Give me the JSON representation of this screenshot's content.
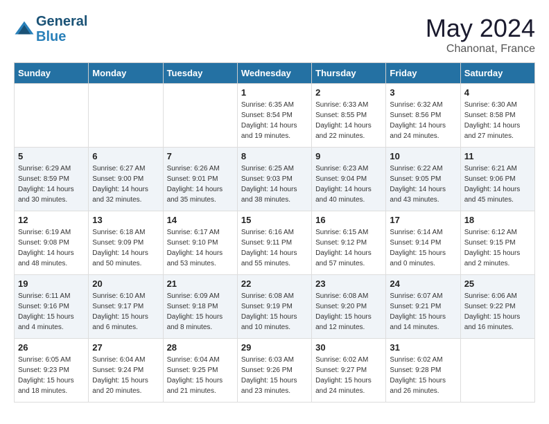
{
  "header": {
    "logo_general": "General",
    "logo_blue": "Blue",
    "month_title": "May 2024",
    "location": "Chanonat, France"
  },
  "days_of_week": [
    "Sunday",
    "Monday",
    "Tuesday",
    "Wednesday",
    "Thursday",
    "Friday",
    "Saturday"
  ],
  "weeks": [
    [
      {
        "day": "",
        "info": ""
      },
      {
        "day": "",
        "info": ""
      },
      {
        "day": "",
        "info": ""
      },
      {
        "day": "1",
        "info": "Sunrise: 6:35 AM\nSunset: 8:54 PM\nDaylight: 14 hours\nand 19 minutes."
      },
      {
        "day": "2",
        "info": "Sunrise: 6:33 AM\nSunset: 8:55 PM\nDaylight: 14 hours\nand 22 minutes."
      },
      {
        "day": "3",
        "info": "Sunrise: 6:32 AM\nSunset: 8:56 PM\nDaylight: 14 hours\nand 24 minutes."
      },
      {
        "day": "4",
        "info": "Sunrise: 6:30 AM\nSunset: 8:58 PM\nDaylight: 14 hours\nand 27 minutes."
      }
    ],
    [
      {
        "day": "5",
        "info": "Sunrise: 6:29 AM\nSunset: 8:59 PM\nDaylight: 14 hours\nand 30 minutes."
      },
      {
        "day": "6",
        "info": "Sunrise: 6:27 AM\nSunset: 9:00 PM\nDaylight: 14 hours\nand 32 minutes."
      },
      {
        "day": "7",
        "info": "Sunrise: 6:26 AM\nSunset: 9:01 PM\nDaylight: 14 hours\nand 35 minutes."
      },
      {
        "day": "8",
        "info": "Sunrise: 6:25 AM\nSunset: 9:03 PM\nDaylight: 14 hours\nand 38 minutes."
      },
      {
        "day": "9",
        "info": "Sunrise: 6:23 AM\nSunset: 9:04 PM\nDaylight: 14 hours\nand 40 minutes."
      },
      {
        "day": "10",
        "info": "Sunrise: 6:22 AM\nSunset: 9:05 PM\nDaylight: 14 hours\nand 43 minutes."
      },
      {
        "day": "11",
        "info": "Sunrise: 6:21 AM\nSunset: 9:06 PM\nDaylight: 14 hours\nand 45 minutes."
      }
    ],
    [
      {
        "day": "12",
        "info": "Sunrise: 6:19 AM\nSunset: 9:08 PM\nDaylight: 14 hours\nand 48 minutes."
      },
      {
        "day": "13",
        "info": "Sunrise: 6:18 AM\nSunset: 9:09 PM\nDaylight: 14 hours\nand 50 minutes."
      },
      {
        "day": "14",
        "info": "Sunrise: 6:17 AM\nSunset: 9:10 PM\nDaylight: 14 hours\nand 53 minutes."
      },
      {
        "day": "15",
        "info": "Sunrise: 6:16 AM\nSunset: 9:11 PM\nDaylight: 14 hours\nand 55 minutes."
      },
      {
        "day": "16",
        "info": "Sunrise: 6:15 AM\nSunset: 9:12 PM\nDaylight: 14 hours\nand 57 minutes."
      },
      {
        "day": "17",
        "info": "Sunrise: 6:14 AM\nSunset: 9:14 PM\nDaylight: 15 hours\nand 0 minutes."
      },
      {
        "day": "18",
        "info": "Sunrise: 6:12 AM\nSunset: 9:15 PM\nDaylight: 15 hours\nand 2 minutes."
      }
    ],
    [
      {
        "day": "19",
        "info": "Sunrise: 6:11 AM\nSunset: 9:16 PM\nDaylight: 15 hours\nand 4 minutes."
      },
      {
        "day": "20",
        "info": "Sunrise: 6:10 AM\nSunset: 9:17 PM\nDaylight: 15 hours\nand 6 minutes."
      },
      {
        "day": "21",
        "info": "Sunrise: 6:09 AM\nSunset: 9:18 PM\nDaylight: 15 hours\nand 8 minutes."
      },
      {
        "day": "22",
        "info": "Sunrise: 6:08 AM\nSunset: 9:19 PM\nDaylight: 15 hours\nand 10 minutes."
      },
      {
        "day": "23",
        "info": "Sunrise: 6:08 AM\nSunset: 9:20 PM\nDaylight: 15 hours\nand 12 minutes."
      },
      {
        "day": "24",
        "info": "Sunrise: 6:07 AM\nSunset: 9:21 PM\nDaylight: 15 hours\nand 14 minutes."
      },
      {
        "day": "25",
        "info": "Sunrise: 6:06 AM\nSunset: 9:22 PM\nDaylight: 15 hours\nand 16 minutes."
      }
    ],
    [
      {
        "day": "26",
        "info": "Sunrise: 6:05 AM\nSunset: 9:23 PM\nDaylight: 15 hours\nand 18 minutes."
      },
      {
        "day": "27",
        "info": "Sunrise: 6:04 AM\nSunset: 9:24 PM\nDaylight: 15 hours\nand 20 minutes."
      },
      {
        "day": "28",
        "info": "Sunrise: 6:04 AM\nSunset: 9:25 PM\nDaylight: 15 hours\nand 21 minutes."
      },
      {
        "day": "29",
        "info": "Sunrise: 6:03 AM\nSunset: 9:26 PM\nDaylight: 15 hours\nand 23 minutes."
      },
      {
        "day": "30",
        "info": "Sunrise: 6:02 AM\nSunset: 9:27 PM\nDaylight: 15 hours\nand 24 minutes."
      },
      {
        "day": "31",
        "info": "Sunrise: 6:02 AM\nSunset: 9:28 PM\nDaylight: 15 hours\nand 26 minutes."
      },
      {
        "day": "",
        "info": ""
      }
    ]
  ]
}
